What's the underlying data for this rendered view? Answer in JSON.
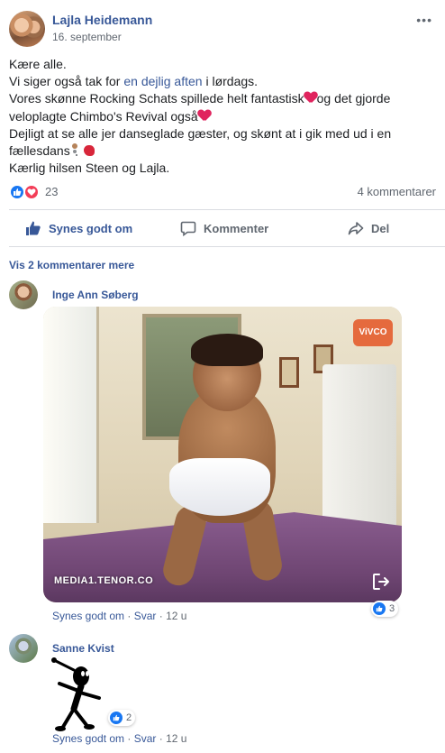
{
  "post": {
    "author": "Lajla Heidemann",
    "date": "16. september",
    "more_label": "•••",
    "body": {
      "line1": "Kære alle.",
      "line2_before": "Vi siger også tak for ",
      "line2_link": "en dejlig aften",
      "line2_after": " i lørdags.",
      "line3": "Vores skønne Rocking Schats spillede helt fantastisk",
      "line3_after": "og det gjorde",
      "line4": "veloplagte Chimbo's Revival også",
      "line5": "Dejligt at se alle jer danseglade gæster, og skønt at i gik med ud i en",
      "line6": "fællesdans",
      "line7": "Kærlig hilsen Steen og Lajla."
    },
    "reactions": {
      "count": "23",
      "comments": "4 kommentarer"
    }
  },
  "actions": {
    "like": "Synes godt om",
    "comment": "Kommenter",
    "share": "Del"
  },
  "more_comments": "Vis 2 kommentarer mere",
  "comments": [
    {
      "name": "Inge Ann Søberg",
      "gif_source": "MEDIA1.TENOR.CO",
      "gif_logo": "ViVCO",
      "like_label": "Synes godt om",
      "sep1": " · ",
      "reply_label": "Svar",
      "sep2": " · ",
      "time": "12 u",
      "reaction_count": "3"
    },
    {
      "name": "Sanne Kvist",
      "like_label": "Synes godt om",
      "sep1": " · ",
      "reply_label": "Svar",
      "sep2": " · ",
      "time": "12 u",
      "reaction_count": "2"
    }
  ],
  "colors": {
    "link_blue": "#385898",
    "like_blue": "#1877f2",
    "love_red": "#f33e58",
    "secondary_text": "#606770"
  }
}
